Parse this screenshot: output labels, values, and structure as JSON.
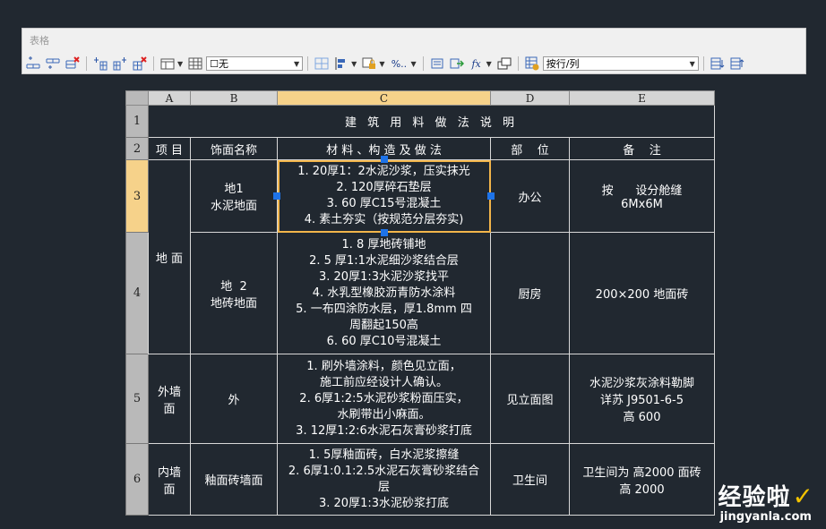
{
  "panel": {
    "title": "表格"
  },
  "toolbar": {
    "row_insert_above": "insert-row-above-icon",
    "row_insert_below": "insert-row-below-icon",
    "row_delete": "delete-row-icon",
    "col_insert_left": "insert-column-left-icon",
    "col_insert_right": "insert-column-right-icon",
    "col_delete": "delete-column-icon",
    "merge_cells": "merge-cells-icon",
    "unmerge_cells": "unmerge-cells-icon",
    "cell_style_value": "☐无",
    "cell_borders": "cell-borders-icon",
    "alignment": "alignment-icon",
    "locking": "locking-icon",
    "data_format": "%..",
    "block": "insert-block-icon",
    "field": "insert-field-icon",
    "formula": "fx",
    "manage_cells": "manage-cell-content-icon",
    "link_cell": "link-cell-icon",
    "link_mode_value": "按行/列",
    "download_changes": "download-changes-icon",
    "upload_changes": "upload-changes-icon"
  },
  "sheet": {
    "columns": [
      "A",
      "B",
      "C",
      "D",
      "E"
    ],
    "active_column": "C",
    "active_row": "3",
    "rows": [
      {
        "num": "1",
        "title": "建 筑 用 料 做 法 说 明"
      },
      {
        "num": "2",
        "cells": [
          "项 目",
          "饰面名称",
          "材 料 、构 造 及 做 法",
          "部    位",
          "备    注"
        ]
      },
      {
        "num": "3",
        "B": [
          "地1",
          "水泥地面"
        ],
        "C": [
          "1. 20厚1：2水泥沙浆，压实抹光",
          "2. 120厚碎石垫层",
          "3. 60 厚C15号混凝土",
          "4. 素土夯实（按规范分层夯实)"
        ],
        "D": "办公",
        "E": [
          "按      设分舱缝",
          "6Mx6M"
        ]
      },
      {
        "num": "4",
        "B": [
          "地  2",
          "地砖地面"
        ],
        "C": [
          "1. 8 厚地砖铺地",
          "2. 5 厚1:1水泥细沙浆结合层",
          "3. 20厚1:3水泥沙浆找平",
          "4. 水乳型橡胶沥青防水涂料",
          "5. 一布四涂防水层，厚1.8mm 四",
          "周翻起150高",
          "6. 60 厚C10号混凝土"
        ],
        "D": "厨房",
        "E": [
          "200×200 地面砖"
        ]
      },
      {
        "num": "5",
        "A": [
          "外墙",
          "面"
        ],
        "B": [
          "外"
        ],
        "C": [
          "1. 刷外墙涂料，颜色见立面，",
          "施工前应经设计人确认。",
          "2. 6厚1:2:5水泥砂浆粉面压实，",
          "水刷带出小麻面。",
          "3. 12厚1:2:6水泥石灰膏砂浆打底"
        ],
        "D": "见立面图",
        "E": [
          "水泥沙浆灰涂料勒脚",
          "详苏 J9501-6-5",
          "高 600"
        ]
      },
      {
        "num": "6",
        "A": [
          "内墙",
          "面"
        ],
        "B": [
          "釉面砖墙面"
        ],
        "C": [
          "1. 5厚釉面砖，白水泥浆擦缝",
          "2. 6厚1:0.1:2.5水泥石灰膏砂浆结合",
          "层",
          "3. 20厚1:3水泥砂浆打底"
        ],
        "D": "卫生间",
        "E": [
          "卫生间为 高2000 面砖",
          "高 2000"
        ]
      }
    ],
    "merged_A_3_4": "地 面"
  },
  "watermark": {
    "main": "经验啦",
    "check": "✓",
    "url": "jingyanla.com"
  },
  "colors": {
    "background": "#212830",
    "selection_outline": "#f2b54a",
    "active_header": "#f6d28a",
    "grip": "#1e73e8"
  }
}
